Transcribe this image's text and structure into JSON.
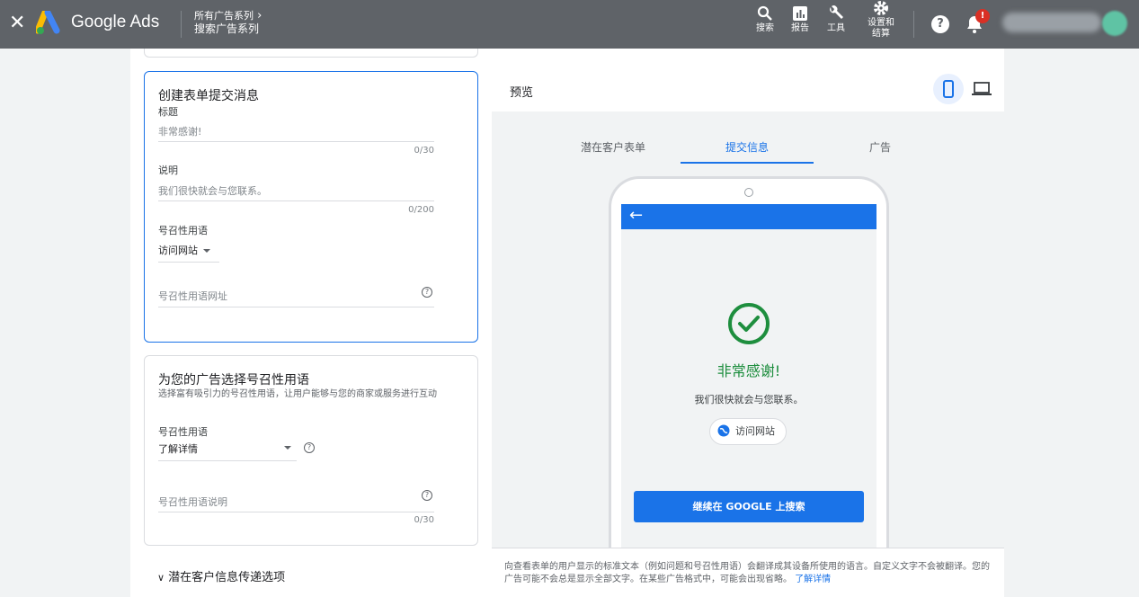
{
  "topbar": {
    "close_glyph": "✕",
    "brand": "Google Ads",
    "breadcrumb_parent": "所有广告系列",
    "breadcrumb_current": "搜索广告系列",
    "tools": [
      {
        "icon": "search-icon",
        "label": "搜索"
      },
      {
        "icon": "reports-icon",
        "label": "报告"
      },
      {
        "icon": "wrench-icon",
        "label": "工具"
      },
      {
        "icon": "gear-icon",
        "label_line1": "设置和",
        "label_line2": "结算"
      }
    ],
    "help_glyph": "?",
    "notif_badge": "!"
  },
  "submit_card": {
    "title": "创建表单提交消息",
    "headline_label": "标题",
    "headline_value": "非常感谢!",
    "headline_count": "0/30",
    "desc_label": "说明",
    "desc_value": "我们很快就会与您联系。",
    "desc_count": "0/200",
    "cta_label": "号召性用语",
    "cta_value": "访问网站",
    "cta_url_placeholder": "号召性用语网址"
  },
  "cta_card": {
    "title": "为您的广告选择号召性用语",
    "description": "选择富有吸引力的号召性用语，让用户能够与您的商家或服务进行互动",
    "cta_label": "号召性用语",
    "cta_value": "了解详情",
    "cta_desc_placeholder": "号召性用语说明",
    "cta_desc_count": "0/30"
  },
  "expander": {
    "label": "潜在客户信息传递选项"
  },
  "preview": {
    "title": "预览",
    "tabs": [
      "潜在客户表单",
      "提交信息",
      "广告"
    ],
    "active_tab": 1,
    "phone": {
      "thanks": "非常感谢!",
      "message": "我们很快就会与您联系。",
      "visit_button": "访问网站",
      "continue_button": "继续在 GOOGLE 上搜索"
    },
    "footer_text": "向查看表单的用户显示的标准文本（例如问题和号召性用语）会翻译成其设备所使用的语言。自定义文字不会被翻译。您的广告可能不会总是显示全部文字。在某些广告格式中，可能会出现省略。",
    "footer_link": "了解详情"
  },
  "colors": {
    "topbar": "#5f6368",
    "accent": "#1a73e8",
    "success": "#1e8e3e",
    "badge": "#d93025"
  }
}
